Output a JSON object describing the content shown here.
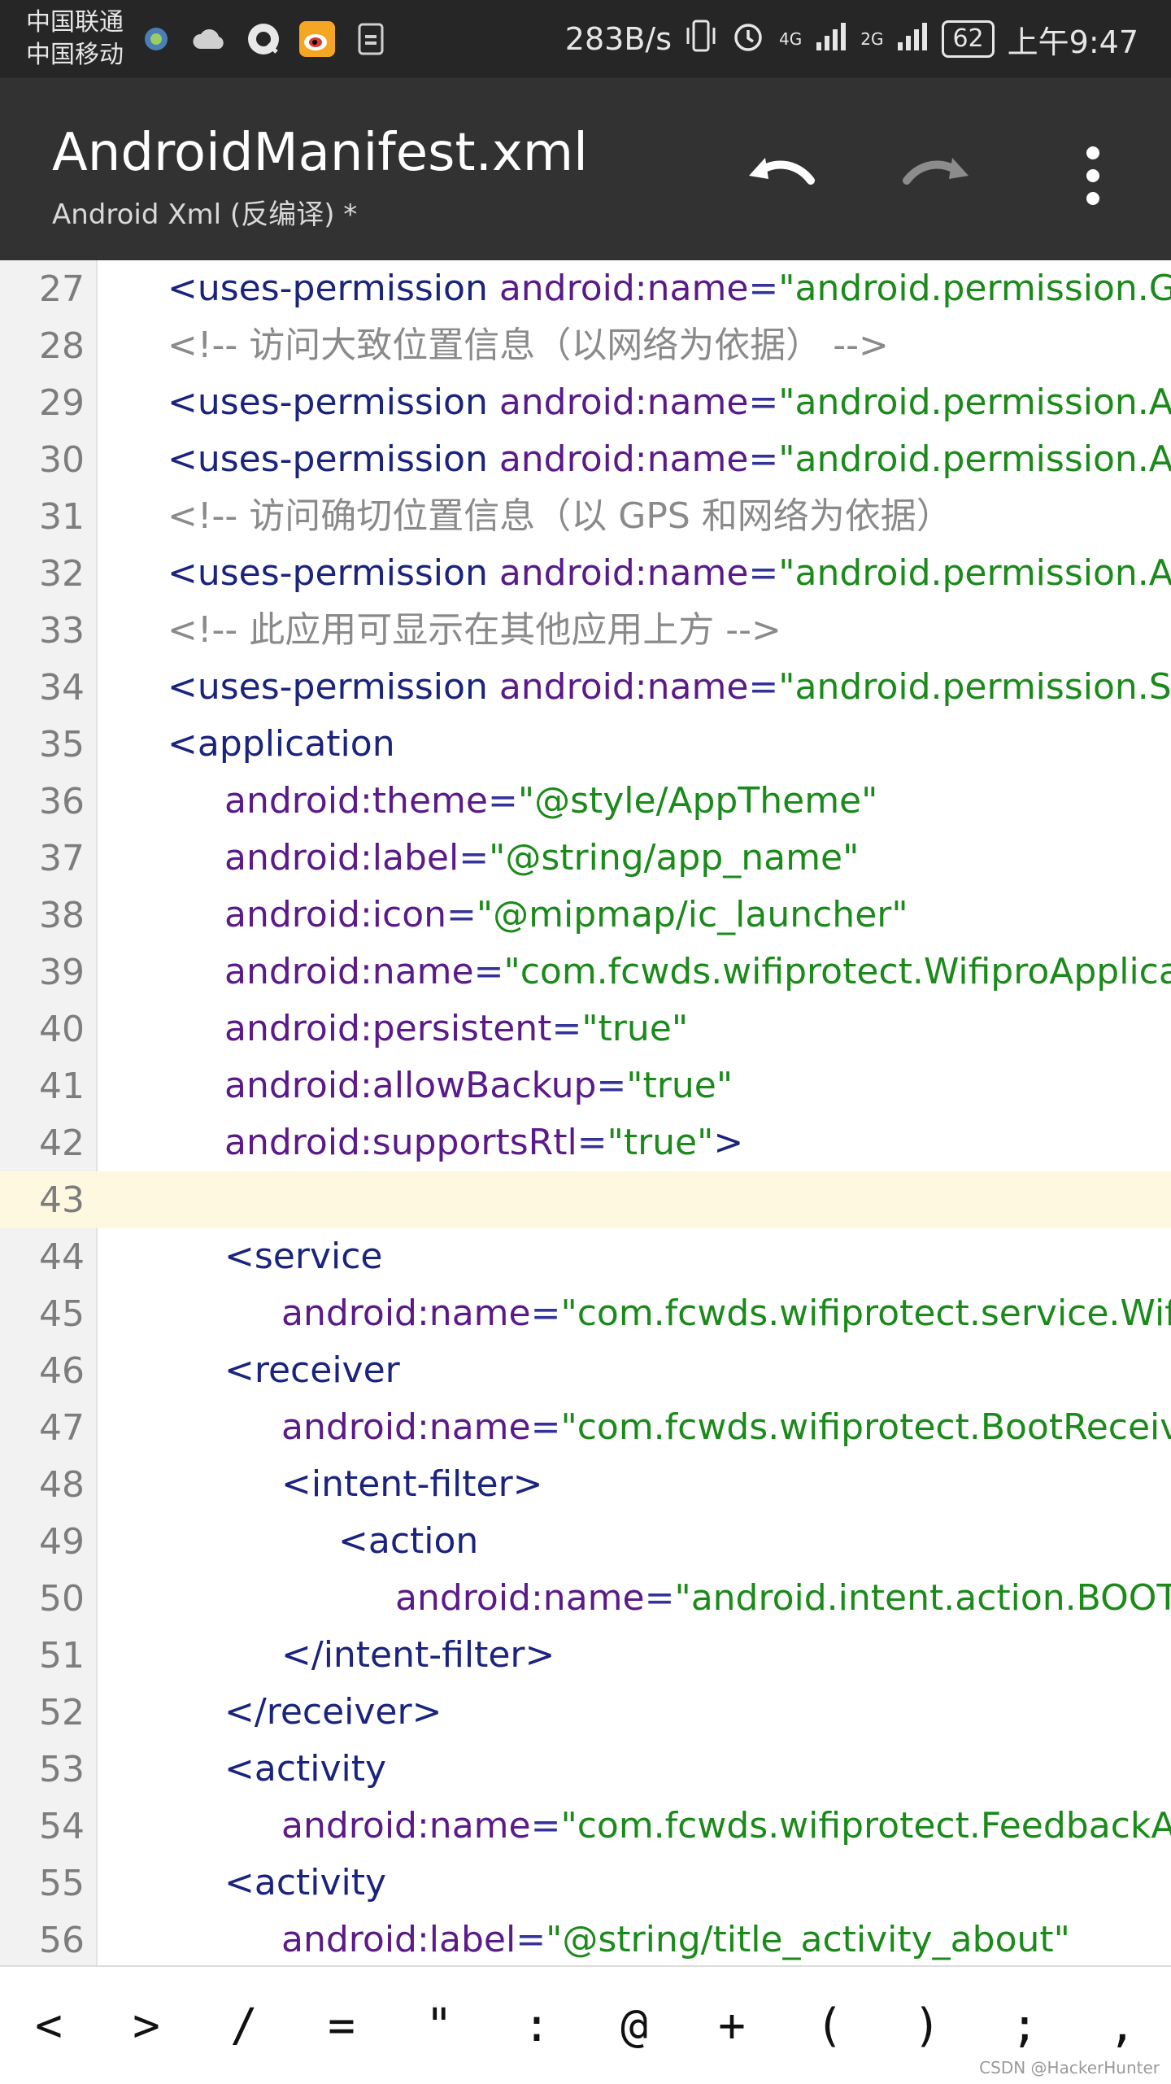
{
  "status_bar": {
    "carrier1": "中国联通",
    "carrier2": "中国移动",
    "speed": "283B/s",
    "net1": "4G",
    "net2": "2G",
    "battery": "62",
    "time": "上午9:47"
  },
  "app_bar": {
    "title": "AndroidManifest.xml",
    "subtitle": "Android Xml (反编译) *"
  },
  "editor": {
    "lines": [
      {
        "n": "27",
        "indent": 1,
        "parts": [
          [
            "tag",
            "<uses-permission "
          ],
          [
            "attr",
            "android:name"
          ],
          [
            "op",
            "="
          ],
          [
            "val",
            "\"android.permission.GET"
          ]
        ]
      },
      {
        "n": "28",
        "indent": 1,
        "parts": [
          [
            "cmt",
            "<!-- 访问大致位置信息（以网络为依据） -->"
          ]
        ]
      },
      {
        "n": "29",
        "indent": 1,
        "parts": [
          [
            "tag",
            "<uses-permission "
          ],
          [
            "attr",
            "android:name"
          ],
          [
            "op",
            "="
          ],
          [
            "val",
            "\"android.permission.ACC"
          ]
        ]
      },
      {
        "n": "30",
        "indent": 1,
        "parts": [
          [
            "tag",
            "<uses-permission "
          ],
          [
            "attr",
            "android:name"
          ],
          [
            "op",
            "="
          ],
          [
            "val",
            "\"android.permission.ACC"
          ]
        ]
      },
      {
        "n": "31",
        "indent": 1,
        "parts": [
          [
            "cmt",
            "<!-- 访问确切位置信息（以 GPS 和网络为依据）"
          ]
        ]
      },
      {
        "n": "32",
        "indent": 1,
        "parts": [
          [
            "tag",
            "<uses-permission "
          ],
          [
            "attr",
            "android:name"
          ],
          [
            "op",
            "="
          ],
          [
            "val",
            "\"android.permission.ACC"
          ]
        ]
      },
      {
        "n": "33",
        "indent": 1,
        "parts": [
          [
            "cmt",
            "<!-- 此应用可显示在其他应用上方 -->"
          ]
        ]
      },
      {
        "n": "34",
        "indent": 1,
        "parts": [
          [
            "tag",
            "<uses-permission "
          ],
          [
            "attr",
            "android:name"
          ],
          [
            "op",
            "="
          ],
          [
            "val",
            "\"android.permission.SYS"
          ]
        ]
      },
      {
        "n": "35",
        "indent": 1,
        "parts": [
          [
            "tag",
            "<application"
          ]
        ]
      },
      {
        "n": "36",
        "indent": 2,
        "parts": [
          [
            "attr",
            "android:theme"
          ],
          [
            "op",
            "="
          ],
          [
            "val",
            "\"@style/AppTheme\""
          ]
        ]
      },
      {
        "n": "37",
        "indent": 2,
        "parts": [
          [
            "attr",
            "android:label"
          ],
          [
            "op",
            "="
          ],
          [
            "val",
            "\"@string/app_name\""
          ]
        ]
      },
      {
        "n": "38",
        "indent": 2,
        "parts": [
          [
            "attr",
            "android:icon"
          ],
          [
            "op",
            "="
          ],
          [
            "val",
            "\"@mipmap/ic_launcher\""
          ]
        ]
      },
      {
        "n": "39",
        "indent": 2,
        "parts": [
          [
            "attr",
            "android:name"
          ],
          [
            "op",
            "="
          ],
          [
            "val",
            "\"com.fcwds.wifiprotect.WifiproApplicat"
          ]
        ]
      },
      {
        "n": "40",
        "indent": 2,
        "parts": [
          [
            "attr",
            "android:persistent"
          ],
          [
            "op",
            "="
          ],
          [
            "val",
            "\"true\""
          ]
        ]
      },
      {
        "n": "41",
        "indent": 2,
        "parts": [
          [
            "attr",
            "android:allowBackup"
          ],
          [
            "op",
            "="
          ],
          [
            "val",
            "\"true\""
          ]
        ]
      },
      {
        "n": "42",
        "indent": 2,
        "parts": [
          [
            "attr",
            "android:supportsRtl"
          ],
          [
            "op",
            "="
          ],
          [
            "val",
            "\"true\""
          ],
          [
            "tag",
            ">"
          ]
        ]
      },
      {
        "n": "43",
        "indent": 0,
        "current": true,
        "parts": []
      },
      {
        "n": "44",
        "indent": 2,
        "parts": [
          [
            "tag",
            "<service"
          ]
        ]
      },
      {
        "n": "45",
        "indent": 3,
        "parts": [
          [
            "attr",
            "android:name"
          ],
          [
            "op",
            "="
          ],
          [
            "val",
            "\"com.fcwds.wifiprotect.service.Wifi"
          ]
        ]
      },
      {
        "n": "46",
        "indent": 2,
        "parts": [
          [
            "tag",
            "<receiver"
          ]
        ]
      },
      {
        "n": "47",
        "indent": 3,
        "parts": [
          [
            "attr",
            "android:name"
          ],
          [
            "op",
            "="
          ],
          [
            "val",
            "\"com.fcwds.wifiprotect.BootReceive"
          ]
        ]
      },
      {
        "n": "48",
        "indent": 3,
        "parts": [
          [
            "tag",
            "<intent-filter>"
          ]
        ]
      },
      {
        "n": "49",
        "indent": 4,
        "parts": [
          [
            "tag",
            "<action"
          ]
        ]
      },
      {
        "n": "50",
        "indent": 5,
        "parts": [
          [
            "attr",
            "android:name"
          ],
          [
            "op",
            "="
          ],
          [
            "val",
            "\"android.intent.action.BOOT"
          ]
        ]
      },
      {
        "n": "51",
        "indent": 3,
        "parts": [
          [
            "tag",
            "</intent-filter>"
          ]
        ]
      },
      {
        "n": "52",
        "indent": 2,
        "parts": [
          [
            "tag",
            "</receiver>"
          ]
        ]
      },
      {
        "n": "53",
        "indent": 2,
        "parts": [
          [
            "tag",
            "<activity"
          ]
        ]
      },
      {
        "n": "54",
        "indent": 3,
        "parts": [
          [
            "attr",
            "android:name"
          ],
          [
            "op",
            "="
          ],
          [
            "val",
            "\"com.fcwds.wifiprotect.FeedbackAc"
          ]
        ]
      },
      {
        "n": "55",
        "indent": 2,
        "parts": [
          [
            "tag",
            "<activity"
          ]
        ]
      },
      {
        "n": "56",
        "indent": 3,
        "parts": [
          [
            "attr",
            "android:label"
          ],
          [
            "op",
            "="
          ],
          [
            "val",
            "\"@string/title_activity_about\""
          ]
        ]
      }
    ]
  },
  "symbols": [
    "<",
    ">",
    "/",
    "=",
    "\"",
    ":",
    "@",
    "+",
    "(",
    ")",
    ";",
    ","
  ],
  "watermark": "CSDN @HackerHunter",
  "colors": {
    "status_bar": "#262626",
    "app_bar": "#323232",
    "tag": "#1a237e",
    "attr": "#5b1a8a",
    "value": "#1b8a1b",
    "comment": "#8a8a8a",
    "current_line": "#fff8e1"
  },
  "icons": {
    "status_left": [
      "browser-icon",
      "cloud-icon",
      "qq-icon",
      "weibo-icon",
      "sim-icon"
    ],
    "status_right": [
      "vibrate-icon",
      "alarm-icon",
      "signal-icon",
      "signal-icon"
    ],
    "app_bar": [
      "undo-icon",
      "redo-icon",
      "more-vert-icon"
    ]
  }
}
